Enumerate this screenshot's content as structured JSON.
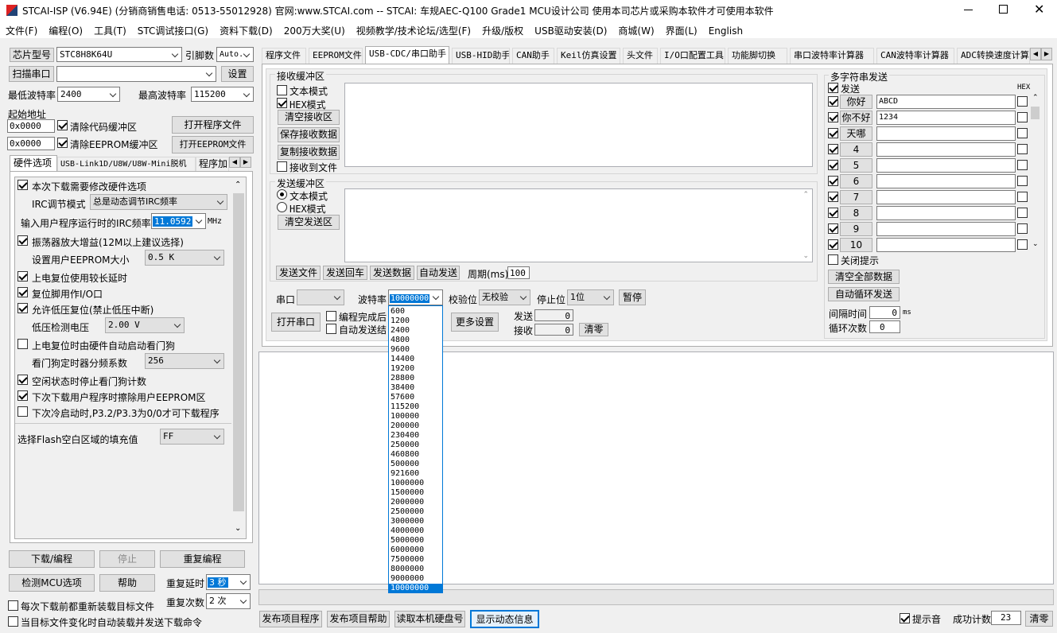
{
  "title": "STCAI-ISP (V6.94E) (分销商销售电话: 0513-55012928) 官网:www.STCAI.com  -- STCAI: 车规AEC-Q100 Grade1 MCU设计公司 使用本司芯片或采购本软件才可使用本软件",
  "menu": [
    "文件(F)",
    "编程(O)",
    "工具(T)",
    "STC调试接口(G)",
    "资料下载(D)",
    "200万大奖(U)",
    "视频教学/技术论坛/选型(F)",
    "升级/版权",
    "USB驱动安装(D)",
    "商城(W)",
    "界面(L)",
    "English"
  ],
  "left": {
    "chip_label": "芯片型号",
    "chip_value": "STC8H8K64U",
    "pins_label": "引脚数",
    "pins_value": "Auto.",
    "scan_btn": "扫描串口",
    "port_value": "",
    "settings_btn": "设置",
    "min_baud_label": "最低波特率",
    "min_baud": "2400",
    "max_baud_label": "最高波特率",
    "max_baud": "115200",
    "start_addr_label": "起始地址",
    "addr1": "0x0000",
    "clear_code": "清除代码缓冲区",
    "open_prog": "打开程序文件",
    "addr2": "0x0000",
    "clear_eeprom": "清除EEPROM缓冲区",
    "open_eeprom": "打开EEPROM文件",
    "subtabs": [
      "硬件选项",
      "USB-Link1D/U8W/U8W-Mini脱机",
      "程序加"
    ],
    "hw": {
      "opt1": "本次下载需要修改硬件选项",
      "irc_mode_label": "IRC调节模式",
      "irc_mode": "总是动态调节IRC频率",
      "irc_freq_label": "输入用户程序运行时的IRC频率",
      "irc_freq": "11.0592",
      "mhz": "MHz",
      "opt2": "振荡器放大增益(12M以上建议选择)",
      "eeprom_size_label": "设置用户EEPROM大小",
      "eeprom_size": "0.5 K",
      "opt3": "上电复位使用较长延时",
      "opt4": "复位脚用作I/O口",
      "opt5": "允许低压复位(禁止低压中断)",
      "lvd_label": "低压检测电压",
      "lvd": "2.00 V",
      "opt6": "上电复位时由硬件自动启动看门狗",
      "wdt_label": "看门狗定时器分频系数",
      "wdt": "256",
      "opt7": "空闲状态时停止看门狗计数",
      "opt8": "下次下载用户程序时擦除用户EEPROM区",
      "opt9": "下次冷启动时,P3.2/P3.3为0/0才可下载程序",
      "flash_fill_label": "选择Flash空白区域的填充值",
      "flash_fill": "FF"
    },
    "download_btn": "下载/编程",
    "stop_btn": "停止",
    "reprog_btn": "重复编程",
    "detect_btn": "检测MCU选项",
    "help_btn": "帮助",
    "repeat_delay_label": "重复延时",
    "repeat_delay": "3 秒",
    "repeat_count_label": "重复次数",
    "repeat_count": "2 次",
    "reload_each": "每次下载前都重新装载目标文件",
    "auto_reload": "当目标文件变化时自动装载并发送下载命令"
  },
  "tabs": [
    "程序文件",
    "EEPROM文件",
    "USB-CDC/串口助手",
    "USB-HID助手",
    "CAN助手",
    "Keil仿真设置",
    "头文件",
    "I/O口配置工具",
    "功能脚切换",
    "串口波特率计算器",
    "CAN波特率计算器",
    "ADC转换速度计算"
  ],
  "serial": {
    "recv_group": "接收缓冲区",
    "text_mode": "文本模式",
    "hex_mode": "HEX模式",
    "clear_recv": "清空接收区",
    "save_recv": "保存接收数据",
    "copy_recv": "复制接收数据",
    "recv_to_file": "接收到文件",
    "send_group": "发送缓冲区",
    "send_text_mode": "文本模式",
    "send_hex_mode": "HEX模式",
    "clear_send": "清空发送区",
    "send_file": "发送文件",
    "send_return": "发送回车",
    "send_data": "发送数据",
    "auto_send": "自动发送",
    "period_label": "周期(ms)",
    "period": "100",
    "port_label": "串口",
    "baud_label": "波特率",
    "baud_value": "10000000",
    "parity_label": "校验位",
    "parity": "无校验",
    "stop_label": "停止位",
    "stop": "1位",
    "pause_btn": "暂停",
    "open_port": "打开串口",
    "after_prog": "编程完成后",
    "auto_send_end": "自动发送结",
    "more_settings": "更多设置",
    "sent_label": "发送",
    "sent": "0",
    "recv_label": "接收",
    "recv": "0",
    "clear_btn": "清零",
    "baud_options": [
      "600",
      "1200",
      "2400",
      "4800",
      "9600",
      "14400",
      "19200",
      "28800",
      "38400",
      "57600",
      "115200",
      "100000",
      "200000",
      "230400",
      "250000",
      "460800",
      "500000",
      "921600",
      "1000000",
      "1500000",
      "2000000",
      "2500000",
      "3000000",
      "4000000",
      "5000000",
      "6000000",
      "7500000",
      "8000000",
      "9000000",
      "10000000"
    ]
  },
  "multi": {
    "group": "多字符串发送",
    "send_label": "发送",
    "hex_label": "HEX",
    "rows": [
      {
        "name": "你好",
        "value": "ABCD"
      },
      {
        "name": "你不好",
        "value": "1234"
      },
      {
        "name": "天哪",
        "value": ""
      },
      {
        "name": "4",
        "value": ""
      },
      {
        "name": "5",
        "value": ""
      },
      {
        "name": "6",
        "value": ""
      },
      {
        "name": "7",
        "value": ""
      },
      {
        "name": "8",
        "value": ""
      },
      {
        "name": "9",
        "value": ""
      },
      {
        "name": "10",
        "value": ""
      }
    ],
    "close_tip": "关闭提示",
    "clear_all": "清空全部数据",
    "auto_cycle": "自动循环发送",
    "interval_label": "间隔时间",
    "interval": "0",
    "ms": "ms",
    "cycle_label": "循环次数",
    "cycle": "0"
  },
  "bottom": {
    "publish_prog": "发布项目程序",
    "publish_help": "发布项目帮助",
    "read_disk": "读取本机硬盘号",
    "show_dynamic": "显示动态信息",
    "tone": "提示音",
    "success_label": "成功计数",
    "success": "23",
    "clear": "清零"
  }
}
